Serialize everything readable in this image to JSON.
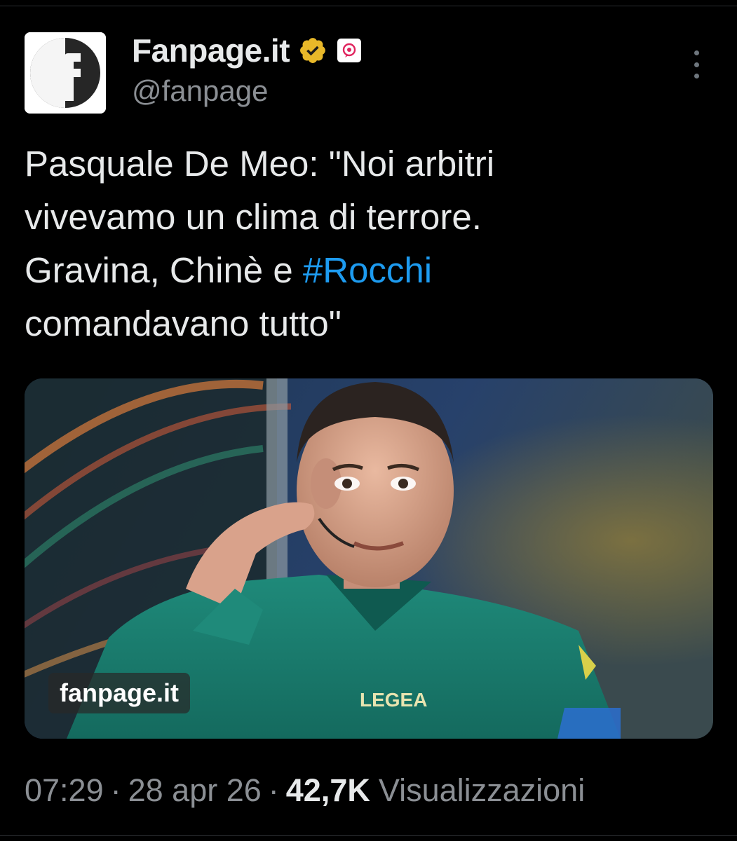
{
  "author": {
    "name": "Fanpage.it",
    "handle": "@fanpage",
    "avatar_icon": "fanpage-f-logo",
    "verified_color": "#e8b829"
  },
  "tweet": {
    "text_lines": [
      "Pasquale De Meo: \"Noi arbitri",
      "vivevamo un clima di terrore.",
      "Gravina, Chinè e ",
      "comandavano tutto\""
    ],
    "hashtag": "#Rocchi",
    "hashtag_color": "#1d9bf0"
  },
  "media": {
    "watermark": "fanpage.it",
    "shirt_text": "LEGEA"
  },
  "meta": {
    "time": "07:29",
    "separator": "·",
    "date": "28 apr 26",
    "views_count": "42,7K",
    "views_label": "Visualizzazioni"
  }
}
